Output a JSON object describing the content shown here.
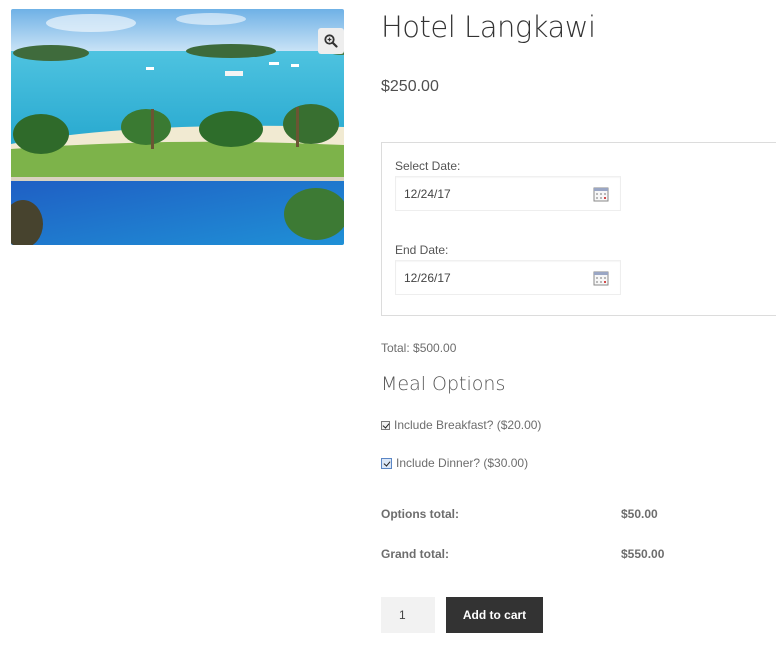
{
  "product": {
    "title": "Hotel Langkawi",
    "price": "$250.00",
    "image": "product-photo",
    "zoom_icon": "zoom-in-icon"
  },
  "booking": {
    "start_label": "Select Date:",
    "start_value": "12/24/17",
    "end_label": "End Date:",
    "end_value": "12/26/17",
    "calendar_icon": "calendar-icon"
  },
  "total_text": "Total: $500.00",
  "meal_options": {
    "heading": "Meal Options",
    "options": [
      {
        "label": "Include Breakfast? ($20.00)",
        "checked": true
      },
      {
        "label": "Include Dinner? ($30.00)",
        "checked": true
      }
    ]
  },
  "summary": {
    "options_total_label": "Options total:",
    "options_total_value": "$50.00",
    "grand_total_label": "Grand total:",
    "grand_total_value": "$550.00"
  },
  "cart": {
    "quantity": "1",
    "add_to_cart_label": "Add to cart"
  },
  "colors": {
    "button_bg": "#333333",
    "button_text": "#ffffff",
    "border": "#dcdcdc"
  }
}
